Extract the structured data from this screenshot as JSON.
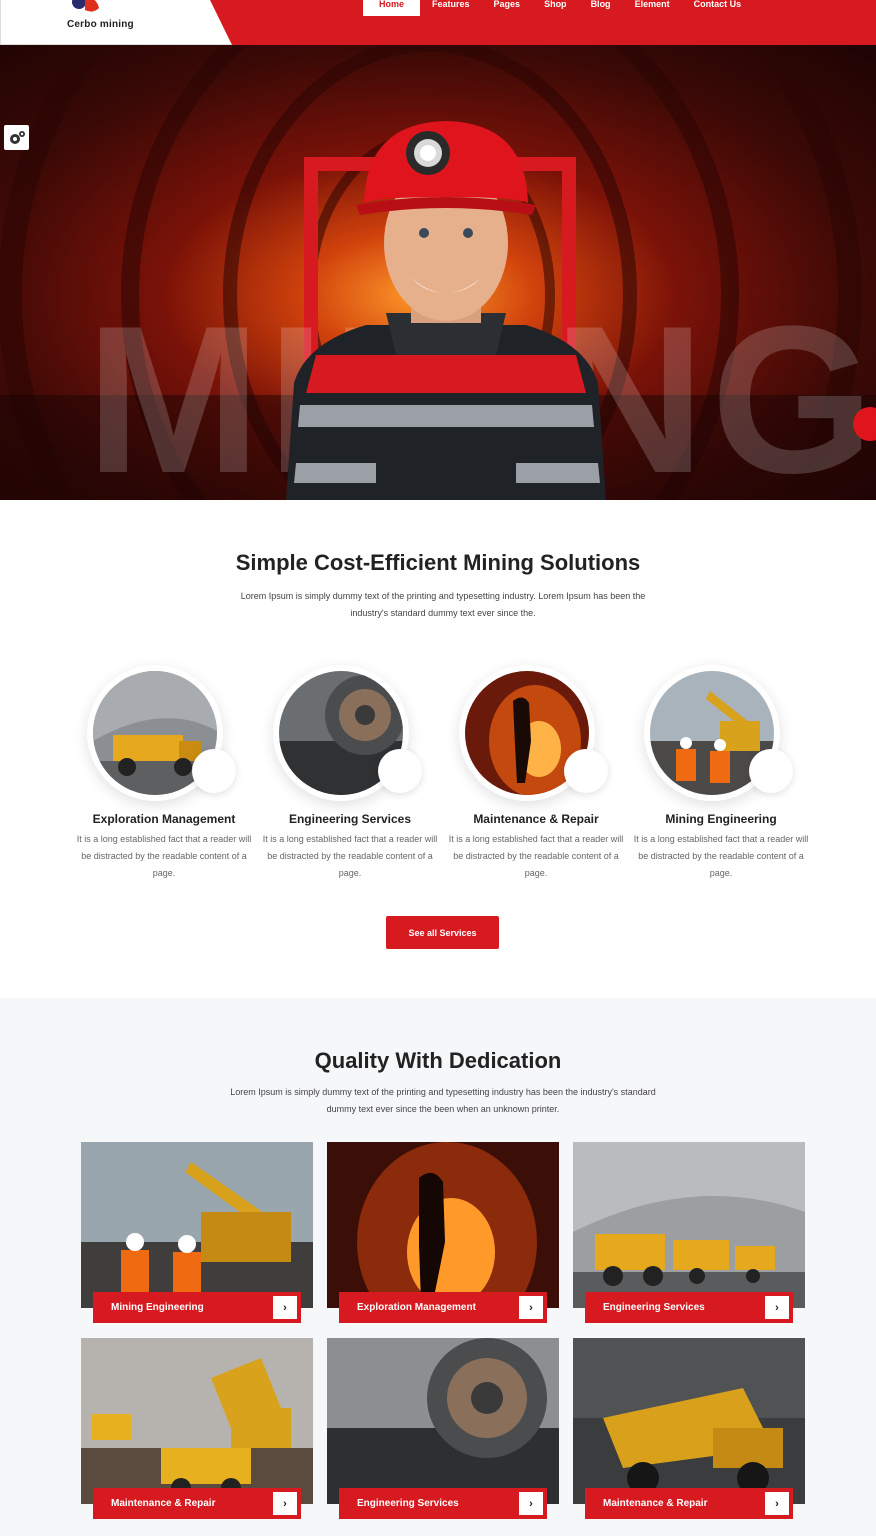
{
  "header": {
    "logo_text": "Cerbo mining",
    "nav": [
      "Home",
      "Features",
      "Pages",
      "Shop",
      "Blog",
      "Element",
      "Contact Us"
    ],
    "active_index": 0
  },
  "hero": {
    "watermark": "MINING."
  },
  "solutions": {
    "title": "Simple Cost-Efficient Mining Solutions",
    "description": "Lorem Ipsum is simply dummy text of the printing and typesetting industry. Lorem Ipsum has been the industry's standard dummy text ever since the.",
    "services": [
      {
        "title": "Exploration Management",
        "text": "It is a long established fact that a reader will be distracted by the readable content of a page."
      },
      {
        "title": "Engineering Services",
        "text": "It is a long established fact that a reader will be distracted by the readable content of a page."
      },
      {
        "title": "Maintenance & Repair",
        "text": "It is a long established fact that a reader will be distracted by the readable content of a page."
      },
      {
        "title": "Mining Engineering",
        "text": "It is a long established fact that a reader will be distracted by the readable content of a page."
      }
    ],
    "button_label": "See all Services"
  },
  "quality": {
    "title": "Quality With Dedication",
    "description": "Lorem Ipsum is simply dummy text of the printing and typesetting industry has been the industry's standard dummy text ever since the been when an unknown printer.",
    "cards": [
      {
        "label": "Mining Engineering"
      },
      {
        "label": "Exploration Management"
      },
      {
        "label": "Engineering Services"
      },
      {
        "label": "Maintenance & Repair"
      },
      {
        "label": "Engineering Services"
      },
      {
        "label": "Maintenance & Repair"
      }
    ],
    "arrow": "›"
  },
  "colors": {
    "brand_red": "#d71920",
    "white": "#ffffff"
  }
}
